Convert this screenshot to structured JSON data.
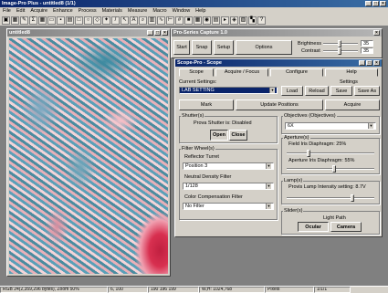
{
  "app": {
    "title": "Image-Pro Plus - untitled8 (1/1)",
    "menu": [
      "File",
      "Edit",
      "Acquire",
      "Enhance",
      "Process",
      "Materials",
      "Measure",
      "Macro",
      "Window",
      "Help"
    ]
  },
  "image_window": {
    "title": "untitled8"
  },
  "capture_bar": {
    "title": "Pro-Series Capture 1.0",
    "start": "Start",
    "snap": "Snap",
    "setup": "Setup",
    "options": "Options",
    "brightness_label": "Brightness",
    "brightness_value": "35",
    "contrast_label": "Contrast",
    "contrast_value": "35"
  },
  "scope": {
    "title": "Scope-Pro - Scope",
    "tabs": [
      "Scope",
      "Acquire / Focus",
      "Configure",
      "Help"
    ],
    "current_settings_label": "Current Settings:",
    "settings_label": "Settings",
    "current_settings_value": "LAB SETTING",
    "load": "Load",
    "reload": "Reload",
    "save": "Save",
    "save_as": "Save As",
    "mark": "Mark",
    "update_positions": "Update Positions",
    "acquire": "Acquire",
    "shutters_label": "Shutter(s)",
    "shutter_status": "Prova Shutter is: Disabled",
    "open": "Open",
    "close": "Close",
    "objectives_label": "Objectives (Objectives)",
    "objective_value": "6X",
    "apertures_label": "Aperture(s)",
    "field_iris": "Field Iris Diaphragm: 25%",
    "aperture_iris": "Aperture Iris Diaphragm: 55%",
    "filter_wheels_label": "Filter Wheel(s)",
    "reflector_label": "Reflector Turret",
    "reflector_value": "Position 3",
    "nd_label": "Neutral Density Filter",
    "nd_value": "1/128",
    "cc_label": "Color Compensation Filter",
    "cc_value": "No Filter",
    "lamps_label": "Lamp(s)",
    "lamp_status": "Provis Lamp Intensity setting: 8.7V",
    "sliders_label": "Slider(s)",
    "light_path_label": "Light Path",
    "ocular": "Ocular",
    "camera": "Camera"
  },
  "status": {
    "info": "RGB 24(2,359,296 bytes), Zoom 50%",
    "coord": "6, 100",
    "color": "190 196 199",
    "size": "W,H: 1024,768",
    "units": "Pixels",
    "page": "1/1/1"
  }
}
